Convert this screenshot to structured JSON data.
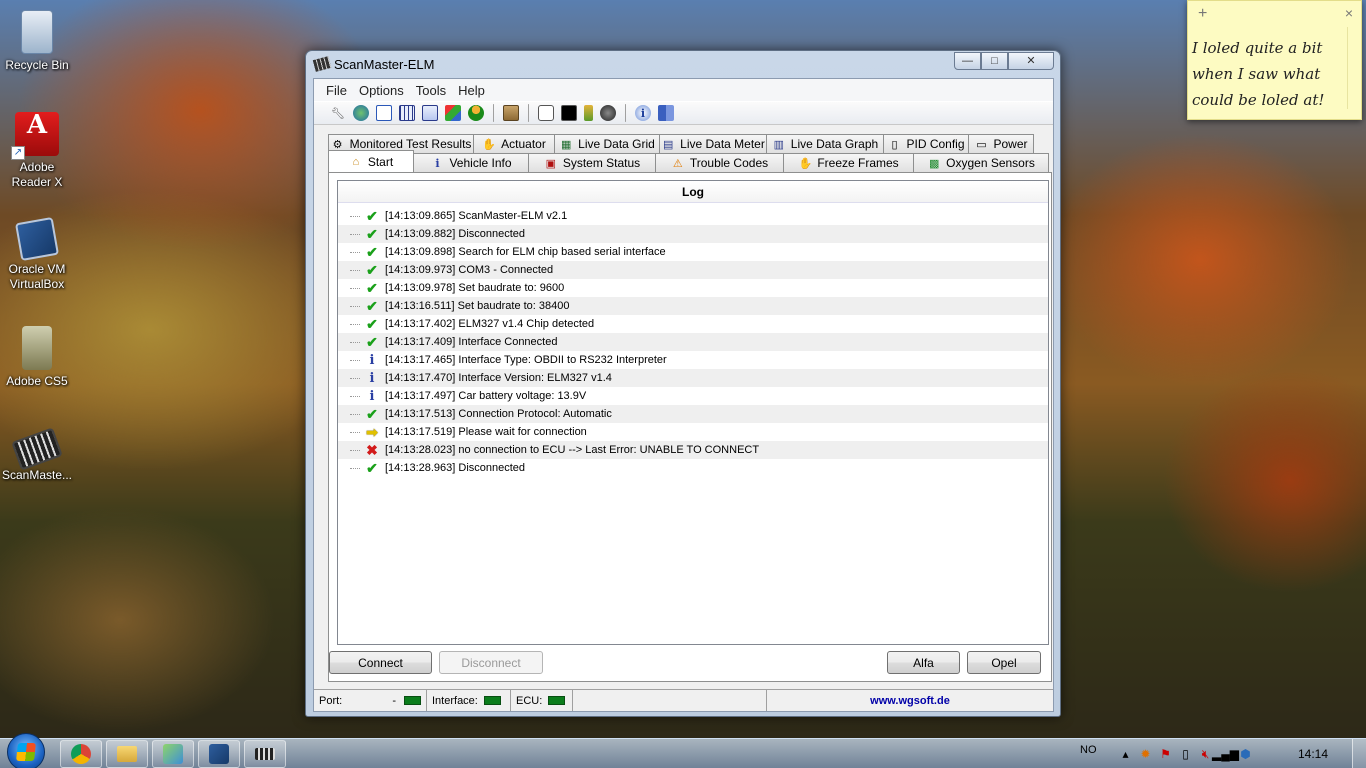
{
  "desktop": {
    "icons": [
      {
        "label": "Recycle Bin"
      },
      {
        "label": "Adobe Reader X"
      },
      {
        "label": "Oracle VM VirtualBox"
      },
      {
        "label": "Adobe CS5"
      },
      {
        "label": "ScanMaste..."
      }
    ]
  },
  "sticky": {
    "plus": "+",
    "close": "×",
    "text": "I loled quite a bit when I saw what could be loled at!"
  },
  "window": {
    "title": "ScanMaster-ELM",
    "controls": {
      "min": "—",
      "max": "□",
      "close": "✕"
    },
    "menu": [
      "File",
      "Options",
      "Tools",
      "Help"
    ],
    "toolbar_icons": [
      "wrench-icon",
      "globe-icon",
      "document-icon",
      "grid-icon",
      "meter-icon",
      "graph-icon",
      "person-icon",
      "sep",
      "clipboard-icon",
      "sep",
      "chat-icon",
      "terminal-icon",
      "battery-icon",
      "gauge-icon",
      "sep",
      "info-icon",
      "book-icon"
    ],
    "tabs_row1": [
      {
        "label": "Monitored Test Results",
        "icon": "gear-icon"
      },
      {
        "label": "Actuator",
        "icon": "hand-icon"
      },
      {
        "label": "Live Data Grid",
        "icon": "grid-icon"
      },
      {
        "label": "Live Data Meter",
        "icon": "meter-icon"
      },
      {
        "label": "Live Data Graph",
        "icon": "graph-icon"
      },
      {
        "label": "PID Config",
        "icon": "doc-icon"
      },
      {
        "label": "Power",
        "icon": "chip-icon"
      }
    ],
    "tabs_row2": [
      {
        "label": "Start",
        "icon": "home-icon",
        "active": true
      },
      {
        "label": "Vehicle Info",
        "icon": "info-icon"
      },
      {
        "label": "System Status",
        "icon": "status-icon"
      },
      {
        "label": "Trouble Codes",
        "icon": "warning-icon"
      },
      {
        "label": "Freeze Frames",
        "icon": "hand-icon"
      },
      {
        "label": "Oxygen Sensors",
        "icon": "sensor-icon"
      }
    ],
    "log": {
      "header": "Log",
      "entries": [
        {
          "status": "ok",
          "text": "[14:13:09.865] ScanMaster-ELM v2.1"
        },
        {
          "status": "ok",
          "text": "[14:13:09.882] Disconnected"
        },
        {
          "status": "ok",
          "text": "[14:13:09.898] Search for ELM chip based serial interface"
        },
        {
          "status": "ok",
          "text": "[14:13:09.973] COM3 - Connected"
        },
        {
          "status": "ok",
          "text": "[14:13:09.978] Set baudrate to: 9600"
        },
        {
          "status": "ok",
          "text": "[14:13:16.511] Set baudrate to: 38400"
        },
        {
          "status": "ok",
          "text": "[14:13:17.402] ELM327 v1.4 Chip detected"
        },
        {
          "status": "ok",
          "text": "[14:13:17.409] Interface Connected"
        },
        {
          "status": "info",
          "text": "[14:13:17.465] Interface Type: OBDII to RS232 Interpreter"
        },
        {
          "status": "info",
          "text": "[14:13:17.470] Interface Version: ELM327 v1.4"
        },
        {
          "status": "info",
          "text": "[14:13:17.497] Car battery voltage: 13.9V"
        },
        {
          "status": "ok",
          "text": "[14:13:17.513] Connection Protocol: Automatic"
        },
        {
          "status": "wait",
          "text": "[14:13:17.519] Please wait for connection"
        },
        {
          "status": "error",
          "text": "[14:13:28.023] no connection to ECU --> Last Error: UNABLE TO CONNECT"
        },
        {
          "status": "ok",
          "text": "[14:13:28.963] Disconnected"
        }
      ]
    },
    "buttons": {
      "connect": "Connect",
      "disconnect": "Disconnect",
      "alfa": "Alfa",
      "opel": "Opel"
    },
    "statusbar": {
      "port_label": "Port:",
      "port_value": "-",
      "interface_label": "Interface:",
      "ecu_label": "ECU:",
      "url": "www.wgsoft.de",
      "led_color": "#0b7d1c"
    }
  },
  "taskbar": {
    "language": "NO",
    "clock": "14:14"
  }
}
